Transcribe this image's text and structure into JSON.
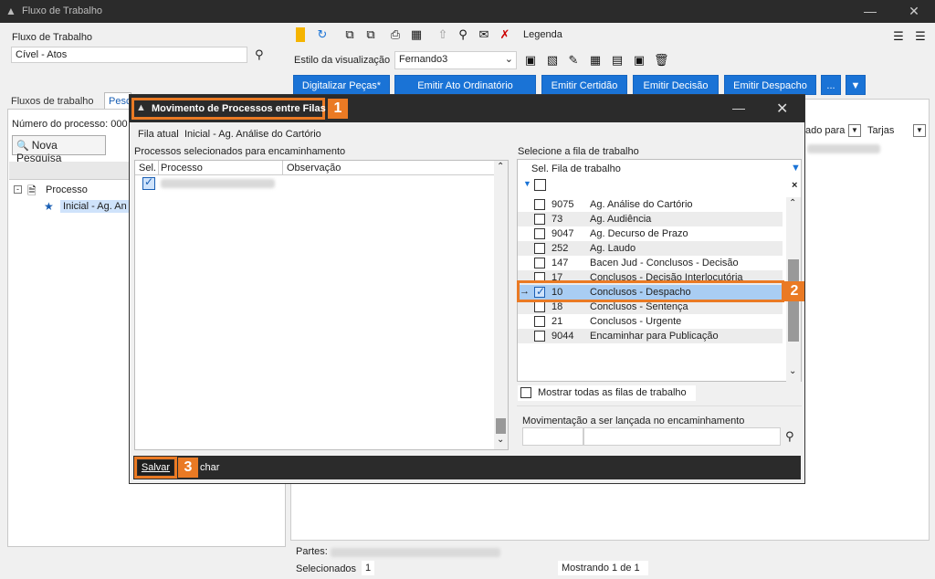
{
  "window": {
    "title": "Fluxo de Trabalho"
  },
  "left": {
    "flow_label": "Fluxo de Trabalho",
    "flow_value": "Cível - Atos",
    "tabs": [
      "Fluxos de trabalho",
      "Pesq"
    ],
    "process_number_label": "Número do processo: 000",
    "new_search": "Nova Pesquisa",
    "tree_root": "Processo",
    "tree_child": "Inicial - Ag. An"
  },
  "toolbar": {
    "legend": "Legenda",
    "view_style_label": "Estilo da visualização",
    "view_style_value": "Fernando3",
    "buttons": [
      "Digitalizar Peças*",
      "Emitir Ato Ordinatório",
      "Emitir Certidão",
      "Emitir Decisão",
      "Emitir Despacho",
      "..."
    ]
  },
  "right_headers": [
    "ado para",
    "Tarjas"
  ],
  "bottom": {
    "parts_label": "Partes:",
    "selected_label": "Selecionados",
    "selected_count": "1",
    "showing": "Mostrando 1 de 1"
  },
  "modal": {
    "title": "Movimento de Processos entre Filas",
    "current_queue_label": "Fila atual",
    "current_queue_value": "Inicial - Ag. Análise do Cartório",
    "left_panel_title": "Processos selecionados para encaminhamento",
    "left_columns": [
      "Sel.",
      "Processo",
      "Observação"
    ],
    "right_panel_title": "Selecione a fila de trabalho",
    "right_columns": [
      "Sel.",
      "Fila de trabalho"
    ],
    "queues": [
      {
        "id": "9075",
        "name": "Ag. Análise do Cartório",
        "checked": false
      },
      {
        "id": "73",
        "name": "Ag. Audiência",
        "checked": false
      },
      {
        "id": "9047",
        "name": "Ag. Decurso de Prazo",
        "checked": false
      },
      {
        "id": "252",
        "name": "Ag. Laudo",
        "checked": false
      },
      {
        "id": "147",
        "name": "Bacen Jud - Conclusos - Decisão",
        "checked": false
      },
      {
        "id": "17",
        "name": "Conclusos - Decisão Interlocutória",
        "checked": false
      },
      {
        "id": "10",
        "name": "Conclusos - Despacho",
        "checked": true
      },
      {
        "id": "18",
        "name": "Conclusos - Sentença",
        "checked": false
      },
      {
        "id": "21",
        "name": "Conclusos - Urgente",
        "checked": false
      },
      {
        "id": "9044",
        "name": "Encaminhar para Publicação",
        "checked": false
      }
    ],
    "show_all_label": "Mostrar todas as filas de trabalho",
    "movement_label": "Movimentação a ser lançada no encaminhamento",
    "save": "Salvar",
    "close_partial": "char"
  },
  "callouts": [
    "1",
    "2",
    "3"
  ],
  "colors": {
    "accent": "#ea7a24",
    "button_blue": "#1a73d6",
    "selected_row": "#a9cdf3"
  }
}
